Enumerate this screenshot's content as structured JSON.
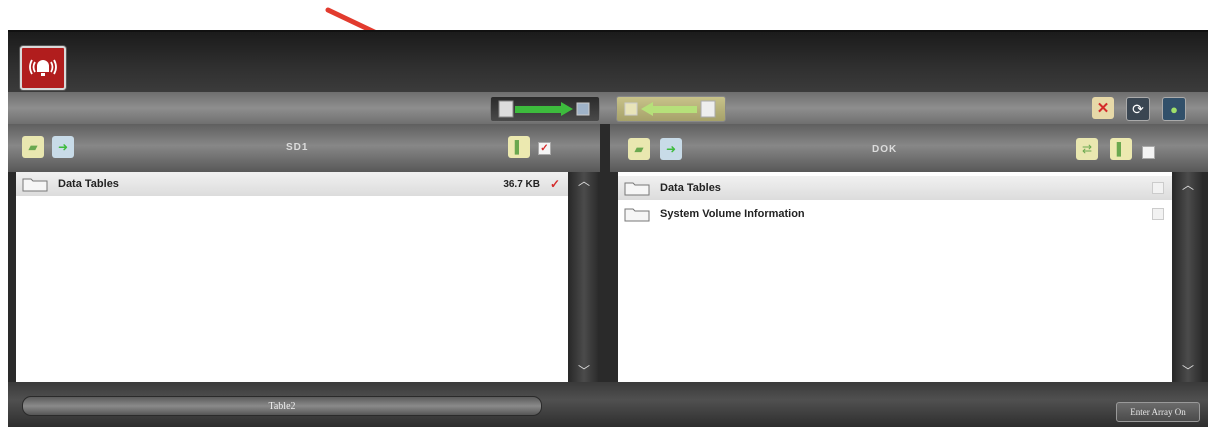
{
  "left_pane": {
    "title": "SD1",
    "items": [
      {
        "name": "Data Tables",
        "size": "36.7 KB",
        "checked": true
      }
    ]
  },
  "right_pane": {
    "title": "DOK",
    "items": [
      {
        "name": "Data Tables"
      },
      {
        "name": "System Volume Information"
      }
    ]
  },
  "bottom": {
    "table_label": "Table2",
    "enter_button": "Enter Array On"
  },
  "colors": {
    "alarm": "#b11d1d",
    "arrow": "#e23b2e",
    "check": "#d42b2b",
    "transfer_green": "#3dbb3d"
  }
}
